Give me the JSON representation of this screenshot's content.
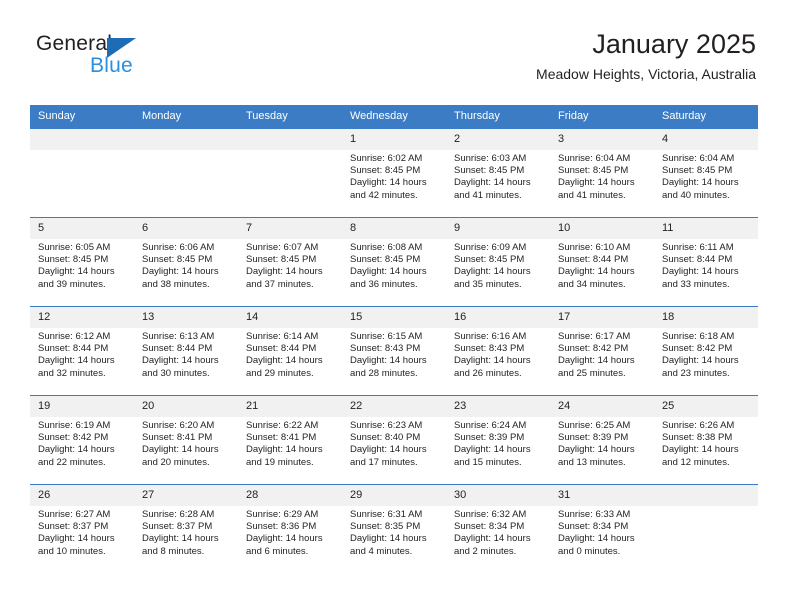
{
  "brand": {
    "name_primary": "General",
    "name_secondary": "Blue",
    "triangle_color": "#1e6cb5",
    "secondary_color": "#2b8fe0"
  },
  "header": {
    "title": "January 2025",
    "subtitle": "Meadow Heights, Victoria, Australia"
  },
  "theme": {
    "header_blue": "#3b7cc4",
    "daynum_band": "#f1f1f1",
    "text": "#231f20"
  },
  "calendar": {
    "weekday_headers": [
      "Sunday",
      "Monday",
      "Tuesday",
      "Wednesday",
      "Thursday",
      "Friday",
      "Saturday"
    ],
    "weeks": [
      [
        {
          "day": "",
          "sunrise": "",
          "sunset": "",
          "daylight": "",
          "empty": true
        },
        {
          "day": "",
          "sunrise": "",
          "sunset": "",
          "daylight": "",
          "empty": true
        },
        {
          "day": "",
          "sunrise": "",
          "sunset": "",
          "daylight": "",
          "empty": true
        },
        {
          "day": "1",
          "sunrise": "Sunrise: 6:02 AM",
          "sunset": "Sunset: 8:45 PM",
          "daylight": "Daylight: 14 hours and 42 minutes."
        },
        {
          "day": "2",
          "sunrise": "Sunrise: 6:03 AM",
          "sunset": "Sunset: 8:45 PM",
          "daylight": "Daylight: 14 hours and 41 minutes."
        },
        {
          "day": "3",
          "sunrise": "Sunrise: 6:04 AM",
          "sunset": "Sunset: 8:45 PM",
          "daylight": "Daylight: 14 hours and 41 minutes."
        },
        {
          "day": "4",
          "sunrise": "Sunrise: 6:04 AM",
          "sunset": "Sunset: 8:45 PM",
          "daylight": "Daylight: 14 hours and 40 minutes."
        }
      ],
      [
        {
          "day": "5",
          "sunrise": "Sunrise: 6:05 AM",
          "sunset": "Sunset: 8:45 PM",
          "daylight": "Daylight: 14 hours and 39 minutes."
        },
        {
          "day": "6",
          "sunrise": "Sunrise: 6:06 AM",
          "sunset": "Sunset: 8:45 PM",
          "daylight": "Daylight: 14 hours and 38 minutes."
        },
        {
          "day": "7",
          "sunrise": "Sunrise: 6:07 AM",
          "sunset": "Sunset: 8:45 PM",
          "daylight": "Daylight: 14 hours and 37 minutes."
        },
        {
          "day": "8",
          "sunrise": "Sunrise: 6:08 AM",
          "sunset": "Sunset: 8:45 PM",
          "daylight": "Daylight: 14 hours and 36 minutes."
        },
        {
          "day": "9",
          "sunrise": "Sunrise: 6:09 AM",
          "sunset": "Sunset: 8:45 PM",
          "daylight": "Daylight: 14 hours and 35 minutes."
        },
        {
          "day": "10",
          "sunrise": "Sunrise: 6:10 AM",
          "sunset": "Sunset: 8:44 PM",
          "daylight": "Daylight: 14 hours and 34 minutes."
        },
        {
          "day": "11",
          "sunrise": "Sunrise: 6:11 AM",
          "sunset": "Sunset: 8:44 PM",
          "daylight": "Daylight: 14 hours and 33 minutes."
        }
      ],
      [
        {
          "day": "12",
          "sunrise": "Sunrise: 6:12 AM",
          "sunset": "Sunset: 8:44 PM",
          "daylight": "Daylight: 14 hours and 32 minutes."
        },
        {
          "day": "13",
          "sunrise": "Sunrise: 6:13 AM",
          "sunset": "Sunset: 8:44 PM",
          "daylight": "Daylight: 14 hours and 30 minutes."
        },
        {
          "day": "14",
          "sunrise": "Sunrise: 6:14 AM",
          "sunset": "Sunset: 8:44 PM",
          "daylight": "Daylight: 14 hours and 29 minutes."
        },
        {
          "day": "15",
          "sunrise": "Sunrise: 6:15 AM",
          "sunset": "Sunset: 8:43 PM",
          "daylight": "Daylight: 14 hours and 28 minutes."
        },
        {
          "day": "16",
          "sunrise": "Sunrise: 6:16 AM",
          "sunset": "Sunset: 8:43 PM",
          "daylight": "Daylight: 14 hours and 26 minutes."
        },
        {
          "day": "17",
          "sunrise": "Sunrise: 6:17 AM",
          "sunset": "Sunset: 8:42 PM",
          "daylight": "Daylight: 14 hours and 25 minutes."
        },
        {
          "day": "18",
          "sunrise": "Sunrise: 6:18 AM",
          "sunset": "Sunset: 8:42 PM",
          "daylight": "Daylight: 14 hours and 23 minutes."
        }
      ],
      [
        {
          "day": "19",
          "sunrise": "Sunrise: 6:19 AM",
          "sunset": "Sunset: 8:42 PM",
          "daylight": "Daylight: 14 hours and 22 minutes."
        },
        {
          "day": "20",
          "sunrise": "Sunrise: 6:20 AM",
          "sunset": "Sunset: 8:41 PM",
          "daylight": "Daylight: 14 hours and 20 minutes."
        },
        {
          "day": "21",
          "sunrise": "Sunrise: 6:22 AM",
          "sunset": "Sunset: 8:41 PM",
          "daylight": "Daylight: 14 hours and 19 minutes."
        },
        {
          "day": "22",
          "sunrise": "Sunrise: 6:23 AM",
          "sunset": "Sunset: 8:40 PM",
          "daylight": "Daylight: 14 hours and 17 minutes."
        },
        {
          "day": "23",
          "sunrise": "Sunrise: 6:24 AM",
          "sunset": "Sunset: 8:39 PM",
          "daylight": "Daylight: 14 hours and 15 minutes."
        },
        {
          "day": "24",
          "sunrise": "Sunrise: 6:25 AM",
          "sunset": "Sunset: 8:39 PM",
          "daylight": "Daylight: 14 hours and 13 minutes."
        },
        {
          "day": "25",
          "sunrise": "Sunrise: 6:26 AM",
          "sunset": "Sunset: 8:38 PM",
          "daylight": "Daylight: 14 hours and 12 minutes."
        }
      ],
      [
        {
          "day": "26",
          "sunrise": "Sunrise: 6:27 AM",
          "sunset": "Sunset: 8:37 PM",
          "daylight": "Daylight: 14 hours and 10 minutes."
        },
        {
          "day": "27",
          "sunrise": "Sunrise: 6:28 AM",
          "sunset": "Sunset: 8:37 PM",
          "daylight": "Daylight: 14 hours and 8 minutes."
        },
        {
          "day": "28",
          "sunrise": "Sunrise: 6:29 AM",
          "sunset": "Sunset: 8:36 PM",
          "daylight": "Daylight: 14 hours and 6 minutes."
        },
        {
          "day": "29",
          "sunrise": "Sunrise: 6:31 AM",
          "sunset": "Sunset: 8:35 PM",
          "daylight": "Daylight: 14 hours and 4 minutes."
        },
        {
          "day": "30",
          "sunrise": "Sunrise: 6:32 AM",
          "sunset": "Sunset: 8:34 PM",
          "daylight": "Daylight: 14 hours and 2 minutes."
        },
        {
          "day": "31",
          "sunrise": "Sunrise: 6:33 AM",
          "sunset": "Sunset: 8:34 PM",
          "daylight": "Daylight: 14 hours and 0 minutes."
        },
        {
          "day": "",
          "sunrise": "",
          "sunset": "",
          "daylight": "",
          "empty": true
        }
      ]
    ]
  }
}
